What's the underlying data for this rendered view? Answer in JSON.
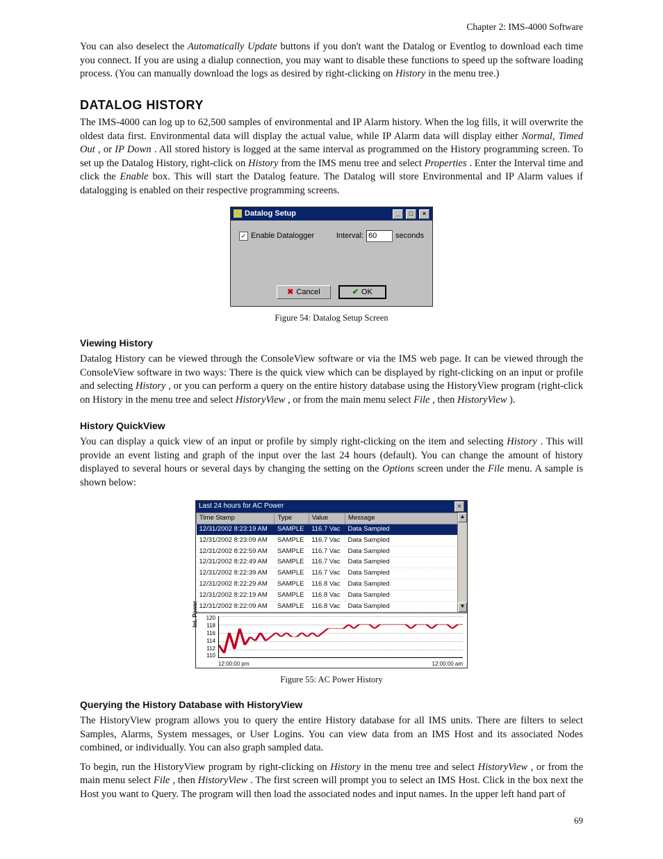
{
  "header": {
    "chapter": "Chapter 2: IMS-4000 Software"
  },
  "intro": {
    "p1_a": "You can also deselect the ",
    "p1_i1": "Automatically Update",
    "p1_b": " buttons if you don't want the Datalog or Eventlog to download each time you connect. If you are using a dialup connection, you may want to disable these functions to speed up the software loading process. (You can manually download the logs as desired by right-clicking on ",
    "p1_i2": "History",
    "p1_c": " in the menu tree.)"
  },
  "datalog": {
    "heading": "DATALOG HISTORY",
    "p_a": "The IMS-4000 can log up to 62,500 samples of environmental and IP Alarm history. When the log fills, it will overwrite the oldest data first. Environmental data will display the actual value, while IP Alarm data will display either ",
    "p_i1": "Normal, Timed Out",
    "p_b": ", or ",
    "p_i2": "IP Down",
    "p_c": ". All stored history is logged at the same interval as programmed on the History programming screen. To set up the Datalog History, right-click on ",
    "p_i3": "History",
    "p_d": " from the IMS menu tree and select ",
    "p_i4": "Properties",
    "p_e": ". Enter the Interval time and click the ",
    "p_i5": "Enable",
    "p_f": " box. This will start the Datalog feature. The Datalog will store Environmental and IP Alarm values if datalogging is enabled on their respective programming screens."
  },
  "fig54": {
    "title": "Datalog Setup",
    "enable_label": "Enable Datalogger",
    "enable_checked": "✓",
    "interval_label": "Interval:",
    "interval_value": "60",
    "interval_units": "seconds",
    "cancel": "Cancel",
    "ok": "OK",
    "caption": "Figure 54: Datalog Setup Screen",
    "min_btn": "_",
    "max_btn": "□",
    "close_btn": "×"
  },
  "viewing": {
    "heading": "Viewing History",
    "p_a": "Datalog History can be viewed through the ConsoleView software or via the IMS web page. It can be viewed through the ConsoleView software in two ways: There is the quick view which can be displayed by right-clicking on an input or profile and selecting ",
    "p_i1": "History",
    "p_b": ", or you can perform a query on the entire history database using the HistoryView program (right-click on History in the menu tree and select ",
    "p_i2": "HistoryView",
    "p_c": ", or from the main menu select ",
    "p_i3": "File",
    "p_d": ", then ",
    "p_i4": "HistoryView",
    "p_e": ")."
  },
  "quickview": {
    "heading": "History QuickView",
    "p_a": "You can display a quick view of an input or profile by simply right-clicking on the item and selecting ",
    "p_i1": "History",
    "p_b": ". This will provide an event listing and graph of the input over the last 24 hours (default). You can change the amount of history displayed to several hours or several days by changing the setting on the ",
    "p_i2": "Options",
    "p_c": " screen under the ",
    "p_i3": "File",
    "p_d": " menu. A sample is shown below:"
  },
  "fig55": {
    "title": "Last 24 hours for AC Power",
    "cols": {
      "ts": "Time Stamp",
      "type": "Type",
      "value": "Value",
      "msg": "Message"
    },
    "rows": [
      {
        "ts": "12/31/2002 8:23:19 AM",
        "type": "SAMPLE",
        "value": "116.7 Vac",
        "msg": "Data Sampled",
        "sel": true
      },
      {
        "ts": "12/31/2002 8:23:09 AM",
        "type": "SAMPLE",
        "value": "116.7 Vac",
        "msg": "Data Sampled"
      },
      {
        "ts": "12/31/2002 8:22:59 AM",
        "type": "SAMPLE",
        "value": "116.7 Vac",
        "msg": "Data Sampled"
      },
      {
        "ts": "12/31/2002 8:22:49 AM",
        "type": "SAMPLE",
        "value": "116.7 Vac",
        "msg": "Data Sampled"
      },
      {
        "ts": "12/31/2002 8:22:39 AM",
        "type": "SAMPLE",
        "value": "116.7 Vac",
        "msg": "Data Sampled"
      },
      {
        "ts": "12/31/2002 8:22:29 AM",
        "type": "SAMPLE",
        "value": "116.8 Vac",
        "msg": "Data Sampled"
      },
      {
        "ts": "12/31/2002 8:22:19 AM",
        "type": "SAMPLE",
        "value": "116.8 Vac",
        "msg": "Data Sampled"
      },
      {
        "ts": "12/31/2002 8:22:09 AM",
        "type": "SAMPLE",
        "value": "116.8 Vac",
        "msg": "Data Sampled"
      }
    ],
    "ylabel": "Int. Power",
    "yticks": [
      "120",
      "118",
      "116",
      "114",
      "112",
      "110"
    ],
    "xleft": "12:00:00 pm",
    "xright": "12:00:00 am",
    "caption": "Figure 55: AC Power History",
    "close_btn": "×"
  },
  "query": {
    "heading": "Querying the History Database with HistoryView",
    "p1": "The HistoryView program allows you to query the entire History database for all IMS units. There are filters to select Samples, Alarms, System messages, or User Logins. You can view data from an IMS Host and its associated Nodes combined, or individually. You can also graph sampled data.",
    "p2_a": "To begin, run the HistoryView program by right-clicking on ",
    "p2_i1": "History",
    "p2_b": " in the menu tree and select ",
    "p2_i2": "HistoryView",
    "p2_c": ", or from the main menu select ",
    "p2_i3": "File",
    "p2_d": ", then ",
    "p2_i4": "HistoryView",
    "p2_e": ". The first screen will prompt you to select an IMS Host. Click in the box next the Host you want to Query. The program will then load the associated nodes and input names. In the upper left hand part of"
  },
  "pagenum": "69",
  "chart_data": {
    "type": "line",
    "title": "Last 24 hours for AC Power",
    "xlabel": "",
    "ylabel": "Int. Power",
    "ylim": [
      110,
      120
    ],
    "xticks": [
      "12:00:00 pm",
      "12:00:00 am"
    ],
    "x": [
      0,
      1,
      2,
      3,
      4,
      5,
      6,
      7,
      8,
      9,
      10,
      11,
      12,
      13,
      14,
      15,
      16,
      17,
      18,
      19,
      20,
      21,
      22,
      23,
      24,
      25,
      26,
      27,
      28,
      29,
      30,
      31,
      32,
      33,
      34,
      35,
      36,
      37,
      38,
      39,
      40,
      41,
      42,
      43,
      44,
      45,
      46,
      47
    ],
    "values": [
      113,
      111,
      116,
      112,
      117,
      113,
      115,
      114,
      116,
      114,
      115,
      116,
      115,
      116,
      115,
      115,
      116,
      115,
      116,
      115,
      116,
      117,
      117,
      117,
      117,
      118,
      117,
      118,
      118,
      118,
      117,
      118,
      118,
      118,
      118,
      118,
      118,
      117,
      118,
      118,
      118,
      117,
      118,
      118,
      118,
      117,
      118,
      118
    ]
  }
}
